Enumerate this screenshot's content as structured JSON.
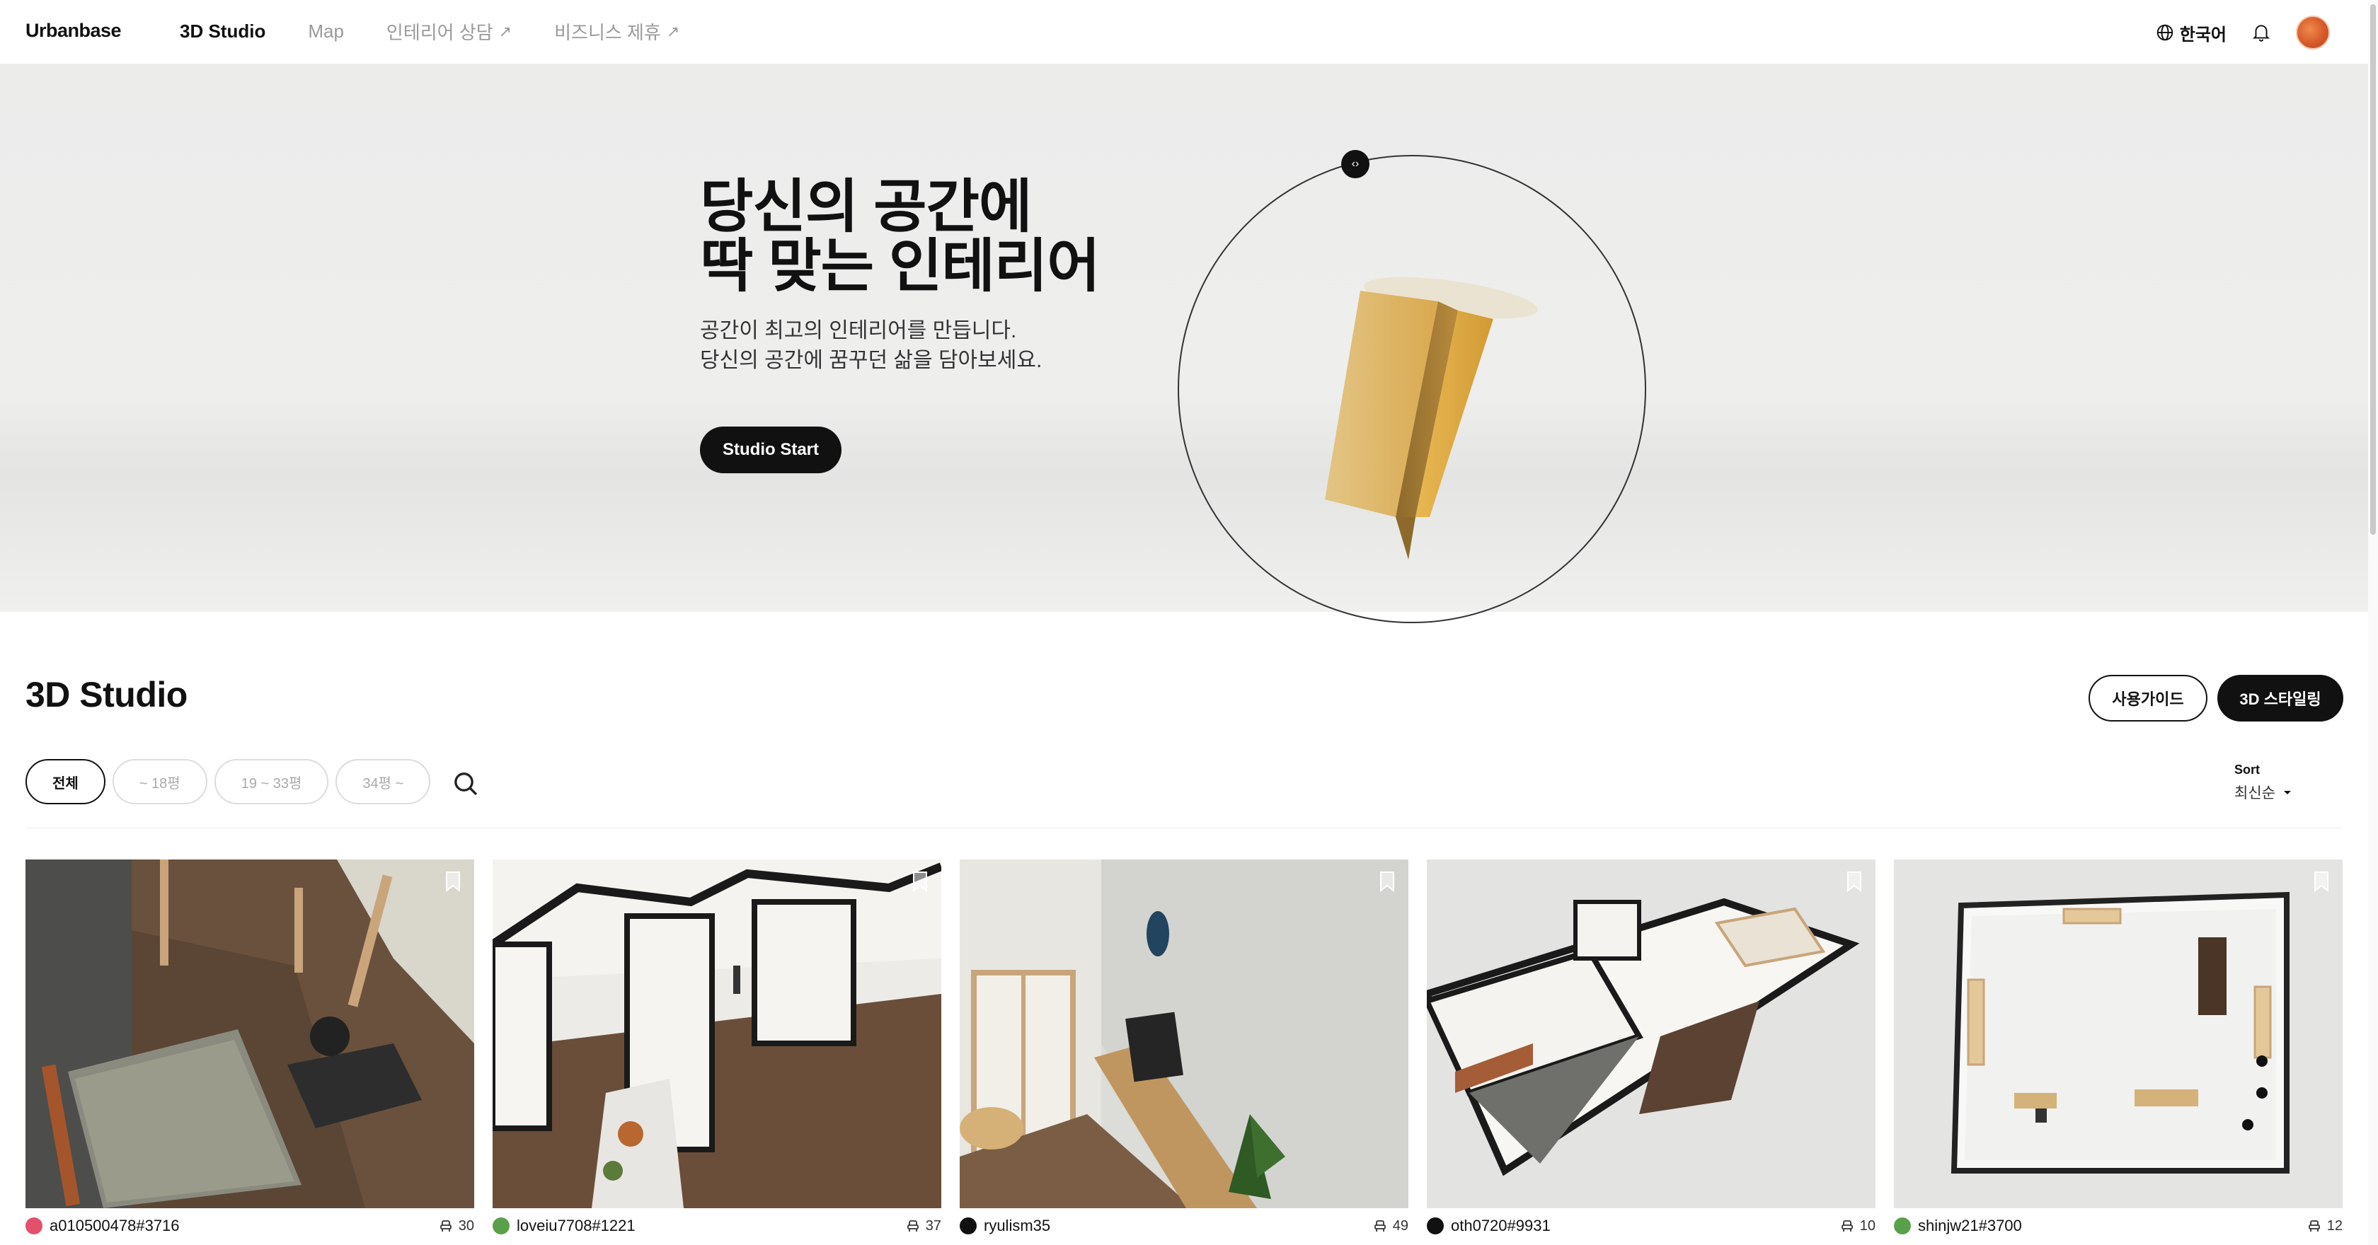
{
  "header": {
    "logo": "Urbanbase",
    "nav": [
      {
        "label": "3D Studio",
        "external": false,
        "active": true
      },
      {
        "label": "Map",
        "external": false,
        "active": false
      },
      {
        "label": "인테리어 상담",
        "external": true,
        "active": false
      },
      {
        "label": "비즈니스 제휴",
        "external": true,
        "active": false
      }
    ],
    "external_arrow": "↗",
    "language": "한국어"
  },
  "hero": {
    "title_line1": "당신의 공간에",
    "title_line2": "딱 맞는 인테리어",
    "subtitle_line1": "공간이 최고의 인테리어를 만듭니다.",
    "subtitle_line2": "당신의 공간에 꿈꾸던 삶을 담아보세요.",
    "cta": "Studio Start"
  },
  "section": {
    "title": "3D Studio",
    "guide_button": "사용가이드",
    "styling_button": "3D 스타일링",
    "filters": [
      "전체",
      "~ 18평",
      "19 ~ 33평",
      "34평 ~"
    ],
    "active_filter_index": 0,
    "sort_label": "Sort",
    "sort_value": "최신순"
  },
  "cards": [
    {
      "author": "a010500478#3716",
      "likes": "30",
      "avatar_color": "#e2506b"
    },
    {
      "author": "loveiu7708#1221",
      "likes": "37",
      "avatar_color": "#5aa04a"
    },
    {
      "author": "ryulism35",
      "likes": "49",
      "avatar_color": "#111111"
    },
    {
      "author": "oth0720#9931",
      "likes": "10",
      "avatar_color": "#111111"
    },
    {
      "author": "shinjw21#3700",
      "likes": "12",
      "avatar_color": "#5aa04a"
    }
  ],
  "icons": {
    "globe": "globe-icon",
    "bell": "bell-icon",
    "search": "search-icon",
    "bookmark": "bookmark-icon",
    "chair": "chair-icon",
    "caret": "caret-down-icon"
  }
}
